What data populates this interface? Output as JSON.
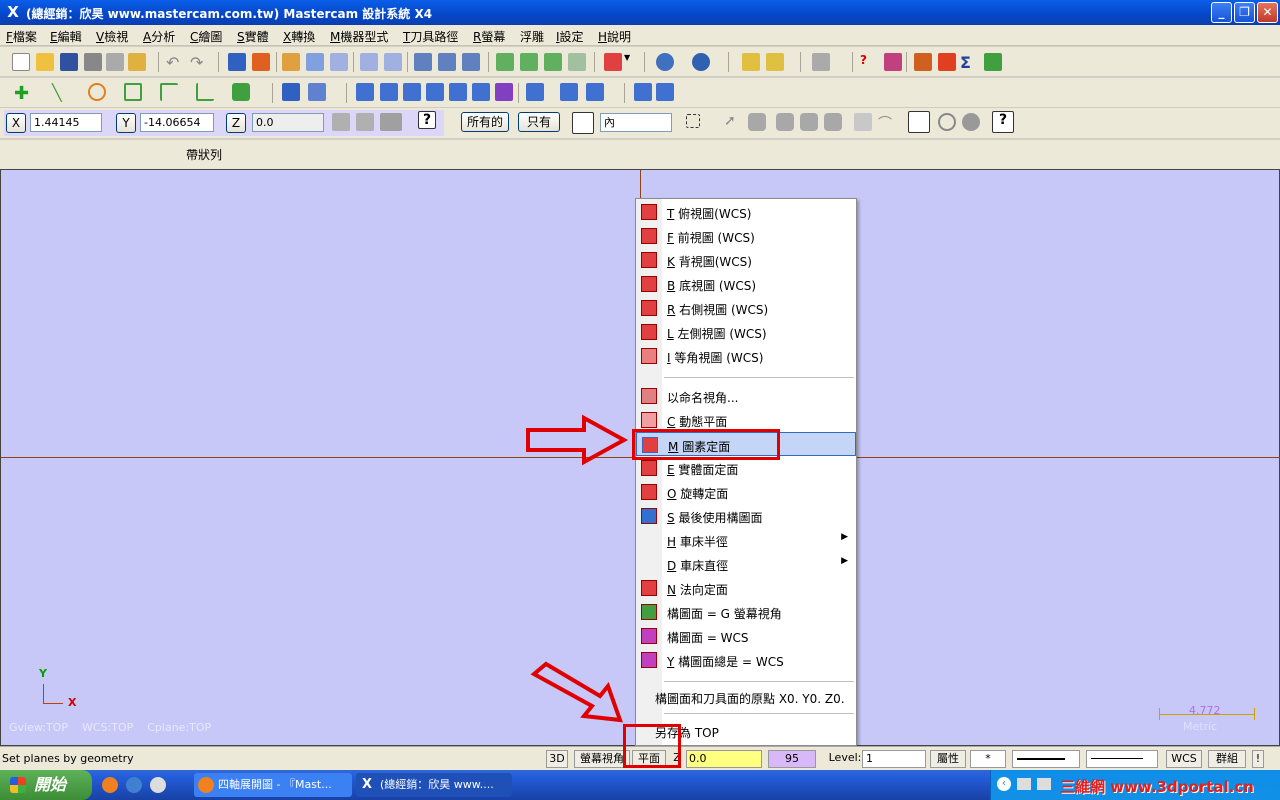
{
  "window": {
    "title": "(總經銷：欣昊 www.mastercam.com.tw) Mastercam 設計系統 X4"
  },
  "menu": [
    {
      "key": "F",
      "label": "檔案"
    },
    {
      "key": "E",
      "label": "編輯"
    },
    {
      "key": "V",
      "label": "檢視"
    },
    {
      "key": "A",
      "label": "分析"
    },
    {
      "key": "C",
      "label": "繪圖"
    },
    {
      "key": "S",
      "label": "實體"
    },
    {
      "key": "X",
      "label": "轉換"
    },
    {
      "key": "M",
      "label": "機器型式"
    },
    {
      "key": "T",
      "label": "刀具路徑"
    },
    {
      "key": "R",
      "label": "螢幕"
    },
    {
      "key": "",
      "label": "浮雕"
    },
    {
      "key": "I",
      "label": "設定"
    },
    {
      "key": "H",
      "label": "說明"
    }
  ],
  "autocursor": {
    "x_label": "X",
    "x_value": "1.44145",
    "y_label": "Y",
    "y_value": "-14.06654",
    "z_label": "Z",
    "z_value": "0.0",
    "all_button": "所有的",
    "only_button": "只有",
    "mode_select": "內"
  },
  "ribbon": {
    "label": "帶狀列"
  },
  "viewport": {
    "axis_y": "Y",
    "axis_x": "X",
    "gview": "Gview:TOP",
    "wcs": "WCS:TOP",
    "cplane": "Cplane:TOP",
    "scale_value": "4.772",
    "scale_unit": "Metric"
  },
  "context_menu": {
    "items": [
      {
        "key": "T",
        "label": "俯視圖(WCS)",
        "icon": "cube-top-icon",
        "color": "#e04040"
      },
      {
        "key": "F",
        "label": "前視圖 (WCS)",
        "icon": "cube-front-icon",
        "color": "#e04040"
      },
      {
        "key": "K",
        "label": "背視圖(WCS)",
        "icon": "cube-back-icon",
        "color": "#e04040"
      },
      {
        "key": "B",
        "label": "底視圖 (WCS)",
        "icon": "cube-bottom-icon",
        "color": "#e04040"
      },
      {
        "key": "R",
        "label": "右側視圖 (WCS)",
        "icon": "cube-right-icon",
        "color": "#e04040"
      },
      {
        "key": "L",
        "label": "左側視圖 (WCS)",
        "icon": "cube-left-icon",
        "color": "#e04040"
      },
      {
        "key": "I",
        "label": "等角視圖 (WCS)",
        "icon": "cube-iso-icon",
        "color": "#e04040"
      },
      {
        "key": "",
        "label": "以命名視角...",
        "icon": "named-view-icon",
        "color": "#d06060"
      },
      {
        "key": "C",
        "label": "動態平面",
        "icon": "dynamic-plane-icon",
        "color": "#e08080"
      },
      {
        "key": "M",
        "label": "圖素定面",
        "icon": "entity-plane-icon",
        "color": "#4060d0"
      },
      {
        "key": "E",
        "label": "實體面定面",
        "icon": "solid-face-icon",
        "color": "#e04040"
      },
      {
        "key": "O",
        "label": "旋轉定面",
        "icon": "rotate-plane-icon",
        "color": "#e04040"
      },
      {
        "key": "S",
        "label": "最後使用構圖面",
        "icon": "last-plane-icon",
        "color": "#3070d0"
      },
      {
        "key": "H",
        "label": "車床半徑",
        "icon": "",
        "color": ""
      },
      {
        "key": "D",
        "label": "車床直徑",
        "icon": "",
        "color": ""
      },
      {
        "key": "N",
        "label": "法向定面",
        "icon": "normal-plane-icon",
        "color": "#e04040"
      },
      {
        "key": "G",
        "label": "構圖面 = G 螢幕視角",
        "icon": "cplane-gview-icon",
        "color": "#40a040"
      },
      {
        "key": "W",
        "label": "構圖面 = WCS",
        "icon": "cplane-wcs-icon",
        "color": "#c040c0"
      },
      {
        "key": "Y",
        "label": "構圖面總是 = WCS",
        "icon": "cplane-always-icon",
        "color": "#c040c0"
      }
    ],
    "origin_item": "構圖面和刀具面的原點 X0. Y0. Z0.",
    "save_as": "另存為 TOP"
  },
  "status": {
    "message": "Set planes by geometry",
    "mode_3d": "3D",
    "gview_btn": "螢幕視角",
    "plane_btn": "平面",
    "z_label": "Z",
    "z_value": "0.0",
    "color_value": "95",
    "level_label": "Level:",
    "level_value": "1",
    "attr_btn": "屬性",
    "point_style": "*",
    "wcs_btn": "WCS",
    "group_btn": "群組"
  },
  "taskbar": {
    "start": "開始",
    "tasks": [
      {
        "label": "四軸展開圖 - 『Mast...",
        "icon": "firefox-icon"
      },
      {
        "label": "(總經銷：欣昊 www....",
        "icon": "mastercam-icon"
      }
    ],
    "watermark": "三維網 www.3dportal.cn"
  },
  "colors": {
    "viewport_bg": "#c8c8f8",
    "axis": "#8b4513",
    "highlight_red": "#e00000",
    "menu_highlight": "#c5d5f5"
  }
}
